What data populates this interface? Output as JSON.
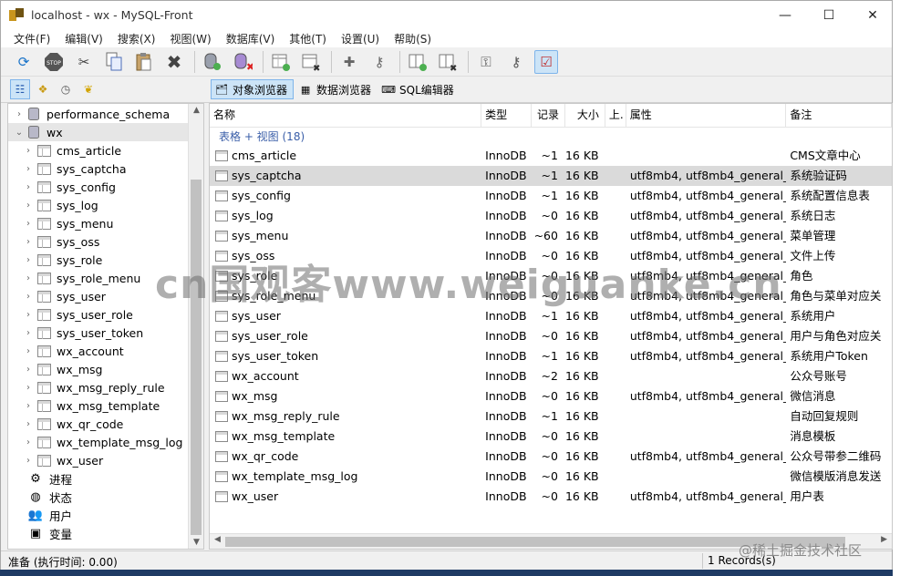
{
  "window": {
    "title": "localhost - wx - MySQL-Front",
    "controls": {
      "minimize": "—",
      "maximize": "☐",
      "close": "✕"
    }
  },
  "menu": [
    "文件(F)",
    "编辑(V)",
    "搜索(X)",
    "视图(W)",
    "数据库(V)",
    "其他(T)",
    "设置(U)",
    "帮助(S)"
  ],
  "toolbar": {
    "icons": [
      "refresh-icon",
      "stop-icon",
      "cut-icon",
      "copy-icon",
      "paste-icon",
      "delete-icon",
      "database-add-icon",
      "database-delete-icon",
      "table-add-icon",
      "table-delete-icon",
      "user-add-icon",
      "user-delete-icon",
      "field-add-icon",
      "field-delete-icon",
      "key-add-icon",
      "key-delete-icon",
      "checklist-icon"
    ]
  },
  "view_tabs": [
    {
      "label": "对象浏览器",
      "active": true
    },
    {
      "label": "数据浏览器",
      "active": false
    },
    {
      "label": "SQL编辑器",
      "active": false
    }
  ],
  "tree": {
    "items": [
      {
        "label": "performance_schema",
        "kind": "db",
        "expand": ">"
      },
      {
        "label": "wx",
        "kind": "db",
        "expand": "v",
        "selected": true
      },
      {
        "label": "cms_article",
        "kind": "table"
      },
      {
        "label": "sys_captcha",
        "kind": "table"
      },
      {
        "label": "sys_config",
        "kind": "table"
      },
      {
        "label": "sys_log",
        "kind": "table"
      },
      {
        "label": "sys_menu",
        "kind": "table"
      },
      {
        "label": "sys_oss",
        "kind": "table"
      },
      {
        "label": "sys_role",
        "kind": "table"
      },
      {
        "label": "sys_role_menu",
        "kind": "table"
      },
      {
        "label": "sys_user",
        "kind": "table"
      },
      {
        "label": "sys_user_role",
        "kind": "table"
      },
      {
        "label": "sys_user_token",
        "kind": "table"
      },
      {
        "label": "wx_account",
        "kind": "table"
      },
      {
        "label": "wx_msg",
        "kind": "table"
      },
      {
        "label": "wx_msg_reply_rule",
        "kind": "table"
      },
      {
        "label": "wx_msg_template",
        "kind": "table"
      },
      {
        "label": "wx_qr_code",
        "kind": "table"
      },
      {
        "label": "wx_template_msg_log",
        "kind": "table"
      },
      {
        "label": "wx_user",
        "kind": "table"
      },
      {
        "label": "进程",
        "kind": "system",
        "icon": "⚙"
      },
      {
        "label": "状态",
        "kind": "system",
        "icon": "◍"
      },
      {
        "label": "用户",
        "kind": "system",
        "icon": "👥"
      },
      {
        "label": "变量",
        "kind": "system",
        "icon": "▣"
      }
    ]
  },
  "grid": {
    "columns": [
      "名称",
      "类型",
      "记录",
      "大小",
      "上.",
      "属性",
      "备注"
    ],
    "group_label": "表格 + 视图 (18)",
    "rows": [
      {
        "name": "cms_article",
        "type": "InnoDB",
        "records": "~1",
        "size": "16 KB",
        "up": "",
        "attr": "",
        "comment": "CMS文章中心"
      },
      {
        "name": "sys_captcha",
        "type": "InnoDB",
        "records": "~1",
        "size": "16 KB",
        "up": "",
        "attr": "utf8mb4, utf8mb4_general_ci",
        "comment": "系统验证码",
        "selected": true
      },
      {
        "name": "sys_config",
        "type": "InnoDB",
        "records": "~1",
        "size": "16 KB",
        "up": "",
        "attr": "utf8mb4, utf8mb4_general_ci",
        "comment": "系统配置信息表"
      },
      {
        "name": "sys_log",
        "type": "InnoDB",
        "records": "~0",
        "size": "16 KB",
        "up": "",
        "attr": "utf8mb4, utf8mb4_general_ci",
        "comment": "系统日志"
      },
      {
        "name": "sys_menu",
        "type": "InnoDB",
        "records": "~60",
        "size": "16 KB",
        "up": "",
        "attr": "utf8mb4, utf8mb4_general_ci",
        "comment": "菜单管理"
      },
      {
        "name": "sys_oss",
        "type": "InnoDB",
        "records": "~0",
        "size": "16 KB",
        "up": "",
        "attr": "utf8mb4, utf8mb4_general_ci",
        "comment": "文件上传"
      },
      {
        "name": "sys_role",
        "type": "InnoDB",
        "records": "~0",
        "size": "16 KB",
        "up": "",
        "attr": "utf8mb4, utf8mb4_general_ci",
        "comment": "角色"
      },
      {
        "name": "sys_role_menu",
        "type": "InnoDB",
        "records": "~0",
        "size": "16 KB",
        "up": "",
        "attr": "utf8mb4, utf8mb4_general_ci",
        "comment": "角色与菜单对应关"
      },
      {
        "name": "sys_user",
        "type": "InnoDB",
        "records": "~1",
        "size": "16 KB",
        "up": "",
        "attr": "utf8mb4, utf8mb4_general_ci",
        "comment": "系统用户"
      },
      {
        "name": "sys_user_role",
        "type": "InnoDB",
        "records": "~0",
        "size": "16 KB",
        "up": "",
        "attr": "utf8mb4, utf8mb4_general_ci",
        "comment": "用户与角色对应关"
      },
      {
        "name": "sys_user_token",
        "type": "InnoDB",
        "records": "~1",
        "size": "16 KB",
        "up": "",
        "attr": "utf8mb4, utf8mb4_general_ci",
        "comment": "系统用户Token"
      },
      {
        "name": "wx_account",
        "type": "InnoDB",
        "records": "~2",
        "size": "16 KB",
        "up": "",
        "attr": "",
        "comment": "公众号账号"
      },
      {
        "name": "wx_msg",
        "type": "InnoDB",
        "records": "~0",
        "size": "16 KB",
        "up": "",
        "attr": "utf8mb4, utf8mb4_general_ci",
        "comment": "微信消息"
      },
      {
        "name": "wx_msg_reply_rule",
        "type": "InnoDB",
        "records": "~1",
        "size": "16 KB",
        "up": "",
        "attr": "",
        "comment": "自动回复规则"
      },
      {
        "name": "wx_msg_template",
        "type": "InnoDB",
        "records": "~0",
        "size": "16 KB",
        "up": "",
        "attr": "",
        "comment": "消息模板"
      },
      {
        "name": "wx_qr_code",
        "type": "InnoDB",
        "records": "~0",
        "size": "16 KB",
        "up": "",
        "attr": "utf8mb4, utf8mb4_general_ci",
        "comment": "公众号带参二维码"
      },
      {
        "name": "wx_template_msg_log",
        "type": "InnoDB",
        "records": "~0",
        "size": "16 KB",
        "up": "",
        "attr": "",
        "comment": "微信模版消息发送"
      },
      {
        "name": "wx_user",
        "type": "InnoDB",
        "records": "~0",
        "size": "16 KB",
        "up": "",
        "attr": "utf8mb4, utf8mb4_general_ci",
        "comment": "用户表"
      }
    ]
  },
  "status": {
    "left": "准备  (执行时间: 0.00)",
    "right": "1 Records(s)"
  },
  "watermark": "cn国观客www.weiguanke.cn",
  "credit": "@稀土掘金技术社区",
  "colors": {
    "accent": "#cce4f7",
    "group_text": "#3a5ea8",
    "selected_row": "#dadada"
  }
}
